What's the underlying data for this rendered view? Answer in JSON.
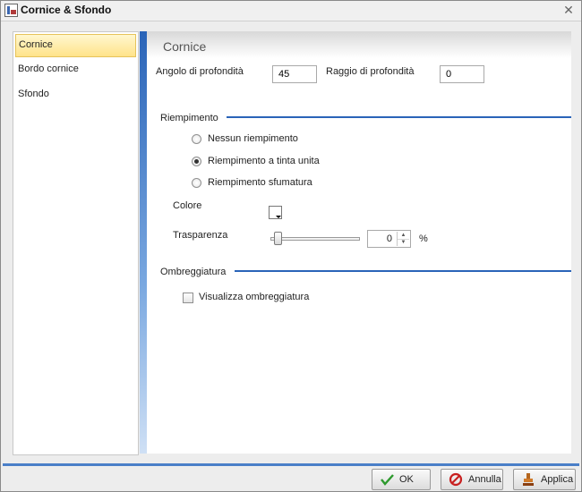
{
  "window": {
    "title": "Cornice & Sfondo"
  },
  "nav": {
    "items": [
      "Cornice",
      "Bordo cornice",
      "Sfondo"
    ]
  },
  "panel": {
    "title": "Cornice",
    "depth_angle_label": "Angolo di profondità",
    "depth_angle_value": "45",
    "depth_radius_label": "Raggio di profondità",
    "depth_radius_value": "0"
  },
  "fill": {
    "group_label": "Riempimento",
    "options": [
      "Nessun riempimento",
      "Riempimento a tinta unita",
      "Riempimento sfumatura"
    ],
    "selected_option": "Riempimento a tinta unita",
    "color_label": "Colore",
    "color_value": "#ffffff",
    "transparency_label": "Trasparenza",
    "transparency_value": "0",
    "transparency_unit": "%"
  },
  "shadow": {
    "group_label": "Ombreggiatura",
    "show_label": "Visualizza ombreggiatura",
    "show_checked": false
  },
  "buttons": {
    "ok": "OK",
    "cancel": "Annulla",
    "apply": "Applica"
  },
  "colors": {
    "accent": "#2a64b8",
    "nav_active": "#ffe38a"
  }
}
